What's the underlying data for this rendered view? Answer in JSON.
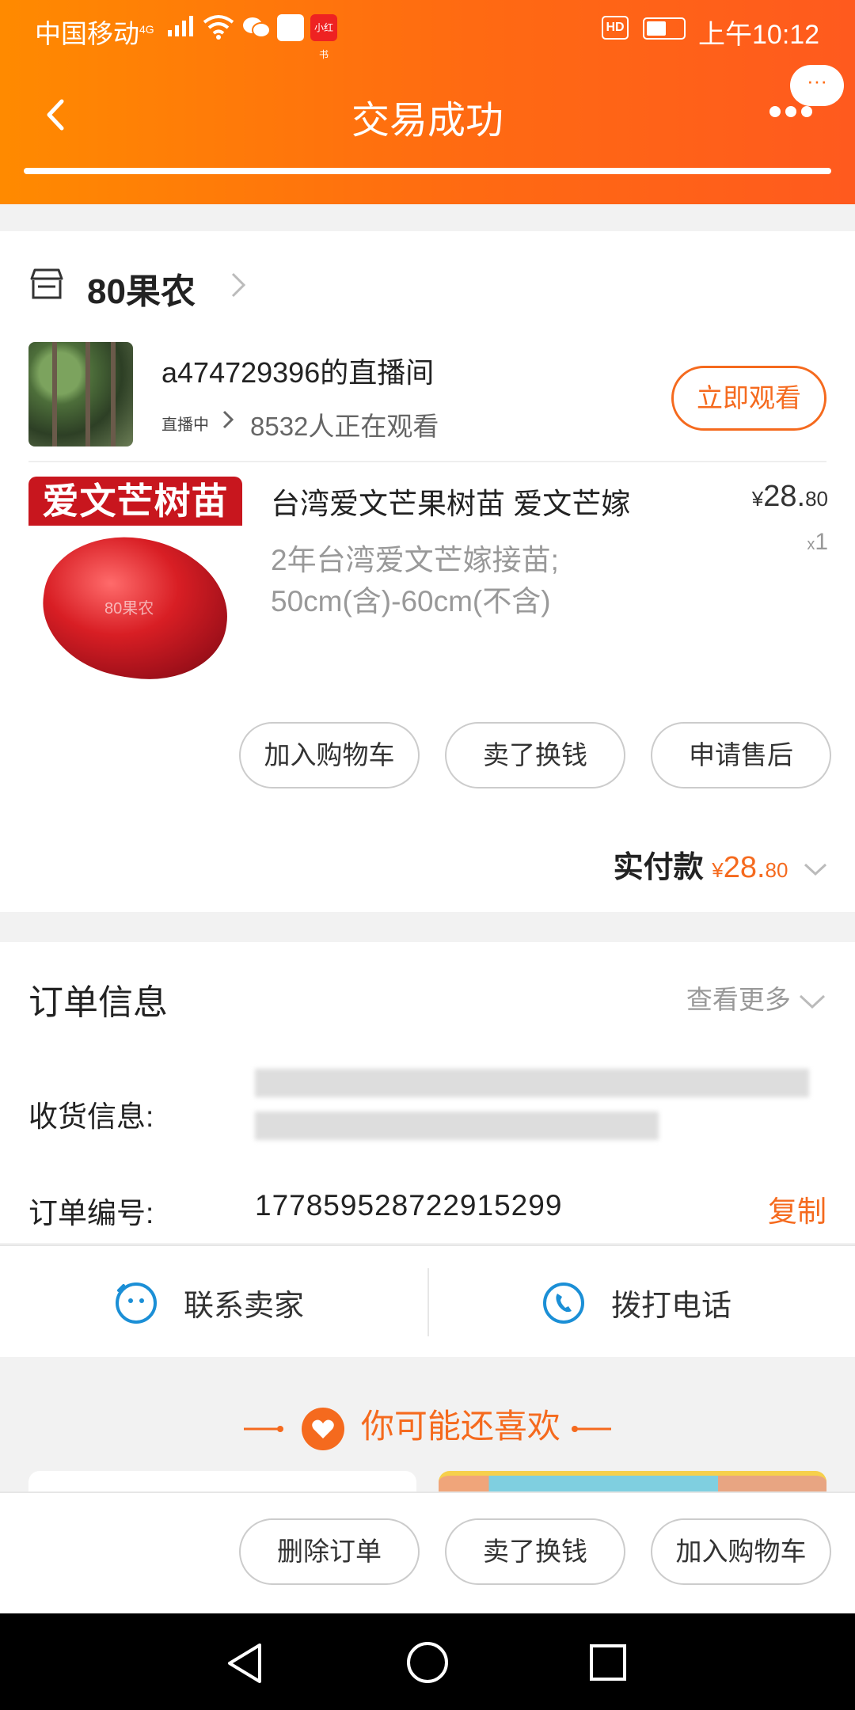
{
  "status_bar": {
    "carrier": "中国移动",
    "network": "4G",
    "time": "上午10:12",
    "hd": "HD",
    "app2": "小红书"
  },
  "header": {
    "title": "交易成功",
    "more_bubble": "···"
  },
  "shop": {
    "name": "80果农"
  },
  "live": {
    "title": "a474729396的直播间",
    "status": "直播中",
    "viewers": "8532人正在观看",
    "watch_button": "立即观看"
  },
  "product": {
    "banner": "爱文芒树苗",
    "watermark": "80果农",
    "title": "台湾爱文芒果树苗  爱文芒嫁",
    "spec_line1": "2年台湾爱文芒嫁接苗;",
    "spec_line2": "50cm(含)-60cm(不含)",
    "currency": "¥",
    "price_int": "28.",
    "price_dec": "80",
    "qty_prefix": "x",
    "qty": "1"
  },
  "item_actions": [
    "加入购物车",
    "卖了换钱",
    "申请售后"
  ],
  "payment": {
    "label": "实付款",
    "currency": "¥",
    "amount_int": "28.",
    "amount_dec": "80"
  },
  "order": {
    "title": "订单信息",
    "more": "查看更多",
    "address_label": "收货信息:",
    "order_no_label": "订单编号:",
    "order_no": "177859528722915299",
    "copy": "复制"
  },
  "contact": {
    "seller": "联系卖家",
    "phone": "拨打电话"
  },
  "recommend": {
    "title": "你可能还喜欢"
  },
  "bottom_actions": [
    "删除订单",
    "卖了换钱",
    "加入购物车"
  ],
  "colors": {
    "accent": "#f56a1e",
    "header_start": "#ff8a00",
    "header_end": "#ff5a1e"
  }
}
